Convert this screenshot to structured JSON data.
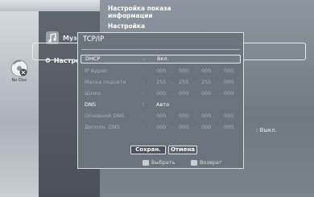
{
  "left": {
    "badge_label": "No Disc"
  },
  "menu": {
    "items": [
      {
        "label": "Музыка"
      },
      {
        "label": "Настройка"
      }
    ]
  },
  "submenu": {
    "items": [
      {
        "label": "Настройка показа"
      },
      {
        "label": "информации"
      },
      {
        "label": "Настройка"
      }
    ],
    "right_value": ": Выкл."
  },
  "dialog": {
    "title": "TCP/IP",
    "rows": [
      {
        "label": "DHCP",
        "value": "Вкл."
      },
      {
        "label": "IP Адрес",
        "ip": [
          "000",
          "000",
          "000",
          "000"
        ]
      },
      {
        "label": "Маска подсети",
        "ip": [
          "255",
          "255",
          "255",
          "000"
        ]
      },
      {
        "label": "Шлюз",
        "ip": [
          "000",
          "000",
          "000",
          "000"
        ]
      },
      {
        "label": "DNS",
        "value": "Авто"
      },
      {
        "label": "Основной DNS",
        "ip": [
          "000",
          "000",
          "000",
          "000"
        ]
      },
      {
        "label": "Дополн. DNS",
        "ip": [
          "000",
          "000",
          "000",
          "000"
        ]
      }
    ],
    "save_label": "Сохран.",
    "cancel_label": "Отмена",
    "hint_select": "Выбрать",
    "hint_return": "Возврат"
  }
}
